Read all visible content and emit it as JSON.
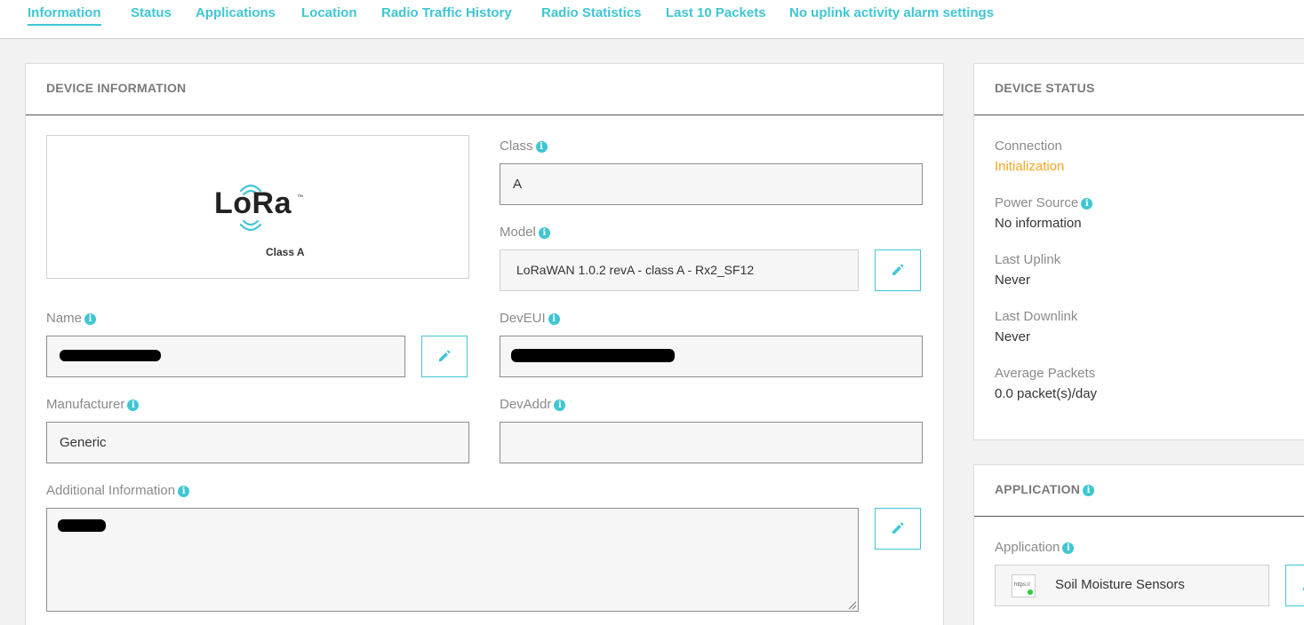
{
  "tabs": [
    {
      "label": "Information",
      "active": true
    },
    {
      "label": "Status"
    },
    {
      "label": "Applications"
    },
    {
      "label": "Location"
    },
    {
      "label": "Radio Traffic History"
    },
    {
      "label": "Radio Statistics"
    },
    {
      "label": "Last 10 Packets"
    },
    {
      "label": "No uplink activity alarm settings"
    }
  ],
  "device_info": {
    "title": "DEVICE INFORMATION",
    "logo": {
      "brand": "LoRa",
      "trademark": "™",
      "caption": "Class A"
    },
    "class": {
      "label": "Class",
      "value": "A"
    },
    "model": {
      "label": "Model",
      "value": "LoRaWAN 1.0.2 revA - class A - Rx2_SF12"
    },
    "name": {
      "label": "Name",
      "value": ""
    },
    "deveui": {
      "label": "DevEUI",
      "value": ""
    },
    "manufacturer": {
      "label": "Manufacturer",
      "value": "Generic"
    },
    "devaddr": {
      "label": "DevAddr",
      "value": ""
    },
    "additional": {
      "label": "Additional Information",
      "value": ""
    }
  },
  "device_status": {
    "title": "DEVICE STATUS",
    "connection": {
      "label": "Connection",
      "value": "Initialization"
    },
    "power_source": {
      "label": "Power Source",
      "value": "No information"
    },
    "last_uplink": {
      "label": "Last Uplink",
      "value": "Never"
    },
    "last_downlink": {
      "label": "Last Downlink",
      "value": "Never"
    },
    "avg_packets": {
      "label": "Average Packets",
      "value": "0.0 packet(s)/day"
    }
  },
  "application": {
    "title": "APPLICATION",
    "label": "Application",
    "icon_text": "https://",
    "value": "Soil Moisture Sensors"
  },
  "colors": {
    "accent": "#3fc6d4",
    "warning": "#f5a623"
  }
}
